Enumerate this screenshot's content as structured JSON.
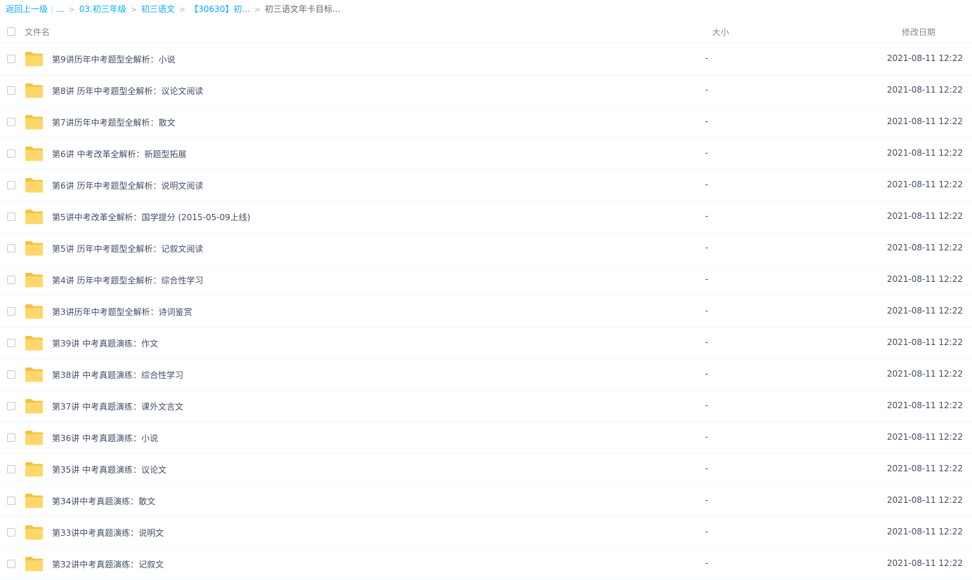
{
  "breadcrumb": {
    "back": "返回上一级",
    "ellipsis": "...",
    "items": [
      "03.初三年级",
      "初三语文",
      "【30630】初..."
    ],
    "current": "初三语文年卡目标..."
  },
  "header": {
    "name": "文件名",
    "size": "大小",
    "modified": "修改日期"
  },
  "files": [
    {
      "name": "第9讲历年中考题型全解析：小说",
      "size": "-",
      "date": "2021-08-11 12:22"
    },
    {
      "name": "第8讲 历年中考题型全解析：议论文阅读",
      "size": "-",
      "date": "2021-08-11 12:22"
    },
    {
      "name": "第7讲历年中考题型全解析：散文",
      "size": "-",
      "date": "2021-08-11 12:22"
    },
    {
      "name": "第6讲 中考改革全解析：新题型拓展",
      "size": "-",
      "date": "2021-08-11 12:22"
    },
    {
      "name": "第6讲 历年中考题型全解析：说明文阅读",
      "size": "-",
      "date": "2021-08-11 12:22"
    },
    {
      "name": "第5讲中考改革全解析：国学提分 (2015-05-09上线)",
      "size": "-",
      "date": "2021-08-11 12:22"
    },
    {
      "name": "第5讲 历年中考题型全解析：记叙文阅读",
      "size": "-",
      "date": "2021-08-11 12:22"
    },
    {
      "name": "第4讲 历年中考题型全解析：综合性学习",
      "size": "-",
      "date": "2021-08-11 12:22"
    },
    {
      "name": "第3讲历年中考题型全解析：诗词鉴赏",
      "size": "-",
      "date": "2021-08-11 12:22"
    },
    {
      "name": "第39讲 中考真题演练：作文",
      "size": "-",
      "date": "2021-08-11 12:22"
    },
    {
      "name": "第38讲 中考真题演练：综合性学习",
      "size": "-",
      "date": "2021-08-11 12:22"
    },
    {
      "name": "第37讲 中考真题演练：课外文言文",
      "size": "-",
      "date": "2021-08-11 12:22"
    },
    {
      "name": "第36讲 中考真题演练：小说",
      "size": "-",
      "date": "2021-08-11 12:22"
    },
    {
      "name": "第35讲 中考真题演练：议论文",
      "size": "-",
      "date": "2021-08-11 12:22"
    },
    {
      "name": "第34讲中考真题演练：散文",
      "size": "-",
      "date": "2021-08-11 12:22"
    },
    {
      "name": "第33讲中考真题演练：说明文",
      "size": "-",
      "date": "2021-08-11 12:22"
    },
    {
      "name": "第32讲中考真题演练：记叙文",
      "size": "-",
      "date": "2021-08-11 12:22"
    }
  ],
  "colors": {
    "link": "#09aaff",
    "folder": "#fcd86a",
    "folder_tab": "#f5c13f",
    "text": "#424e67"
  }
}
